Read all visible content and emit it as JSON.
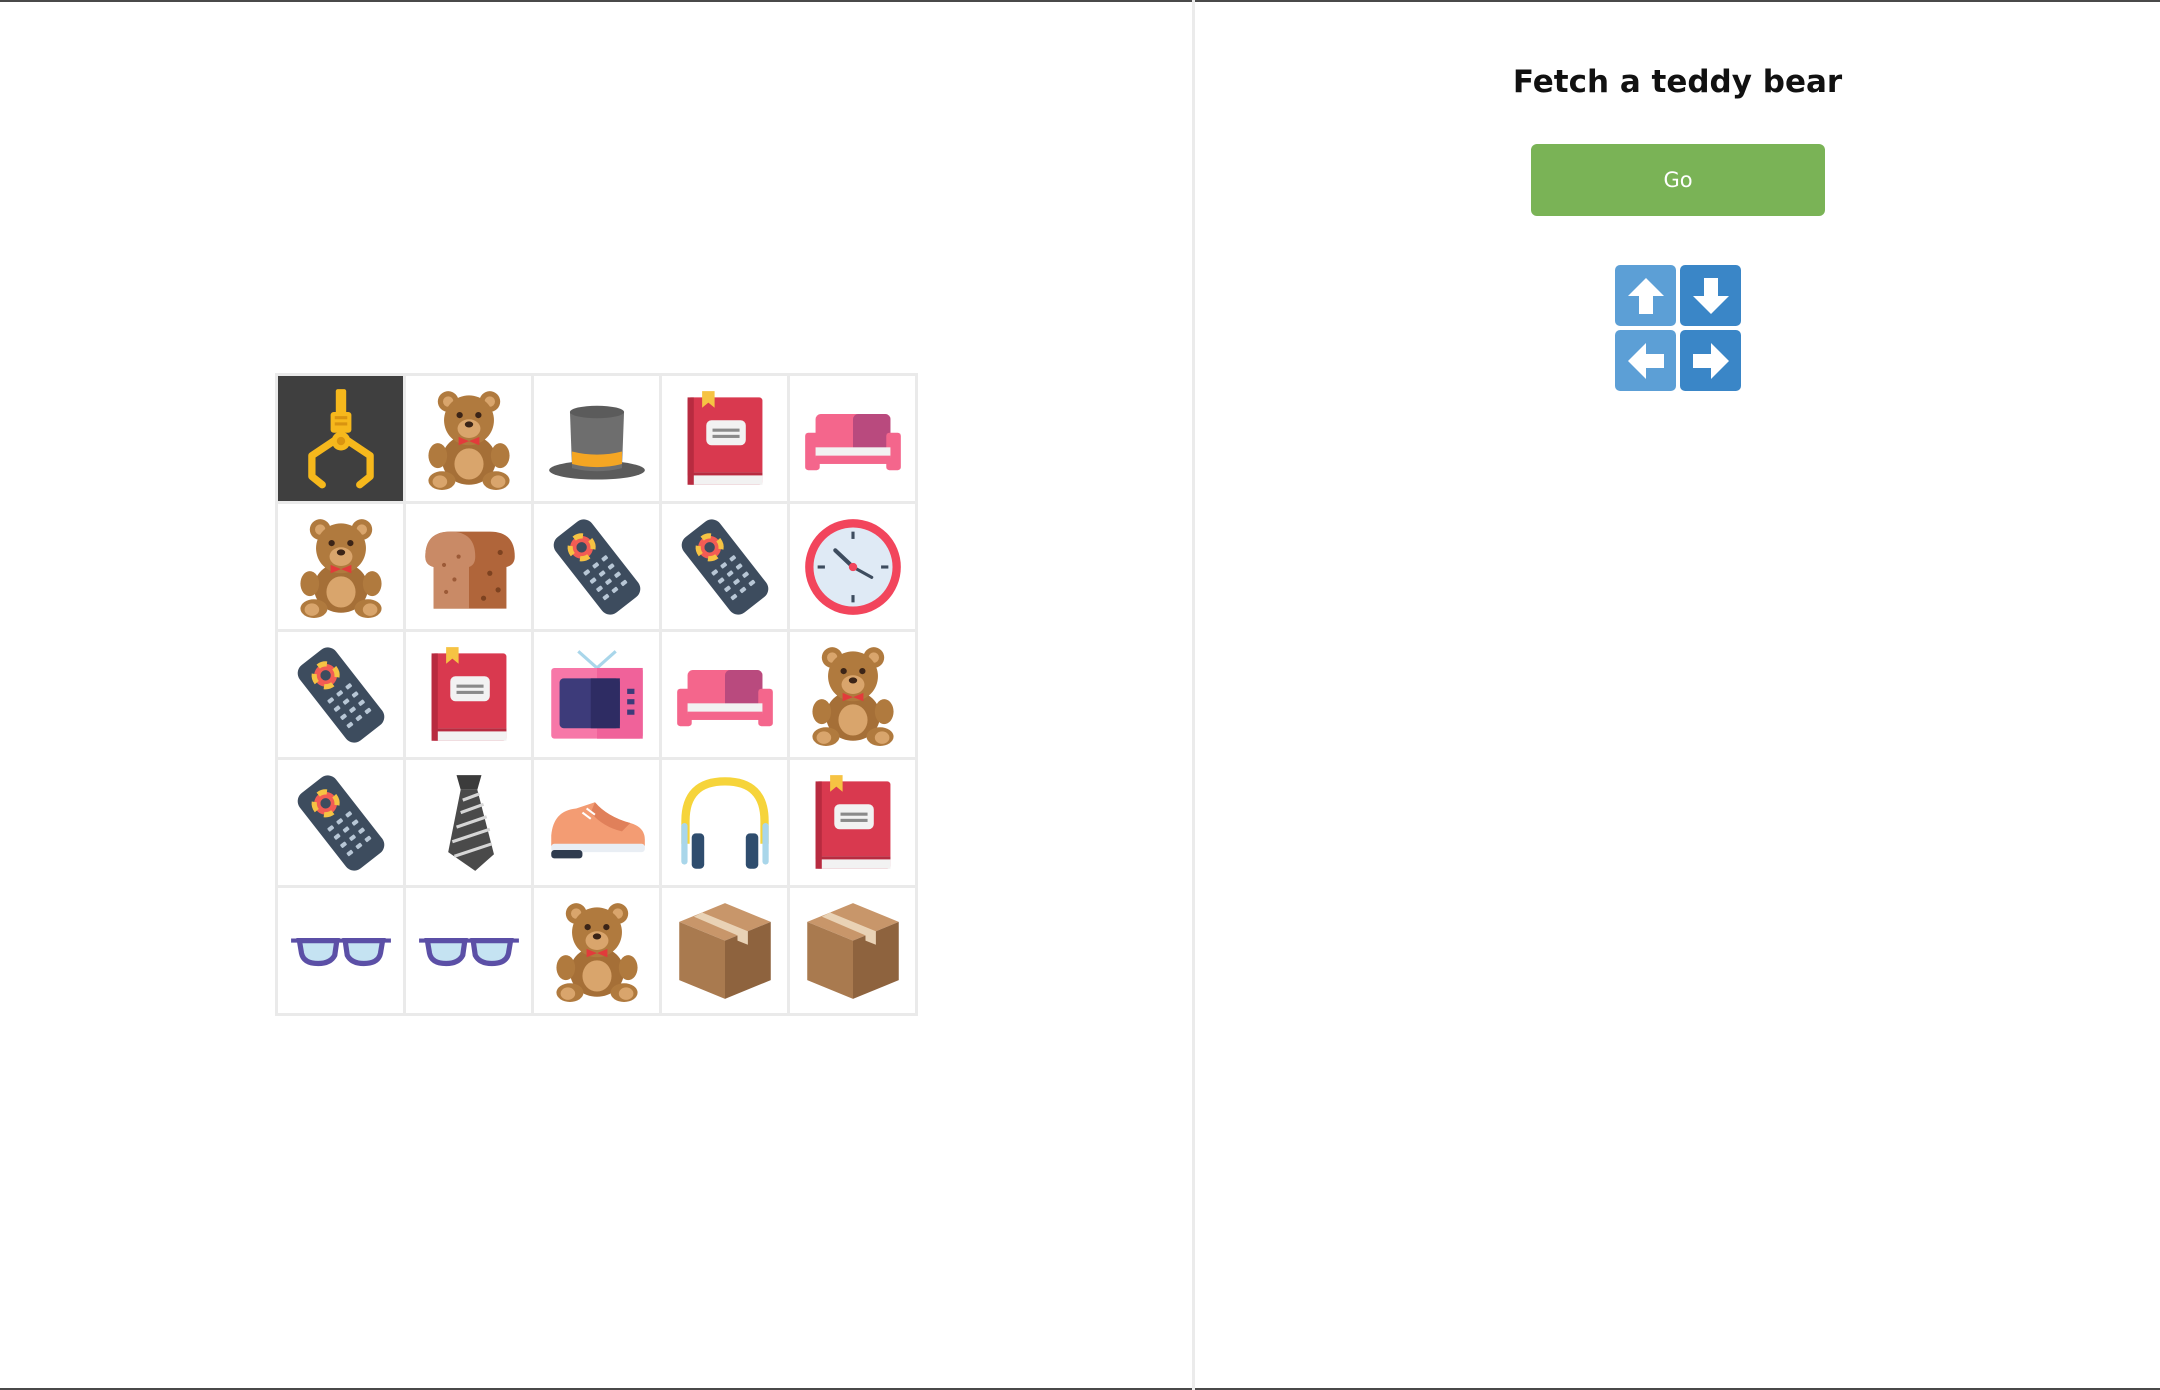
{
  "task": {
    "title": "Fetch a teddy bear",
    "go_label": "Go"
  },
  "controls": [
    {
      "name": "up-arrow-button",
      "icon": "arrow-up-icon",
      "dir": "up",
      "shade": "light"
    },
    {
      "name": "down-arrow-button",
      "icon": "arrow-down-icon",
      "dir": "down",
      "shade": "dark"
    },
    {
      "name": "left-arrow-button",
      "icon": "arrow-left-icon",
      "dir": "left",
      "shade": "light"
    },
    {
      "name": "right-arrow-button",
      "icon": "arrow-right-icon",
      "dir": "right",
      "shade": "dark"
    }
  ],
  "colors": {
    "go_button": "#7ab356",
    "dpad_light": "#5c9fd6",
    "dpad_dark": "#3a86c7",
    "claw_cell": "#3f3f3f"
  },
  "grid": [
    [
      "claw",
      "teddy-bear",
      "top-hat",
      "book",
      "sofa"
    ],
    [
      "teddy-bear",
      "bread",
      "remote",
      "remote",
      "clock"
    ],
    [
      "remote",
      "book",
      "tv",
      "sofa",
      "teddy-bear"
    ],
    [
      "remote",
      "tie",
      "sneaker",
      "headphones",
      "book"
    ],
    [
      "glasses",
      "glasses",
      "teddy-bear",
      "box",
      "box"
    ]
  ]
}
